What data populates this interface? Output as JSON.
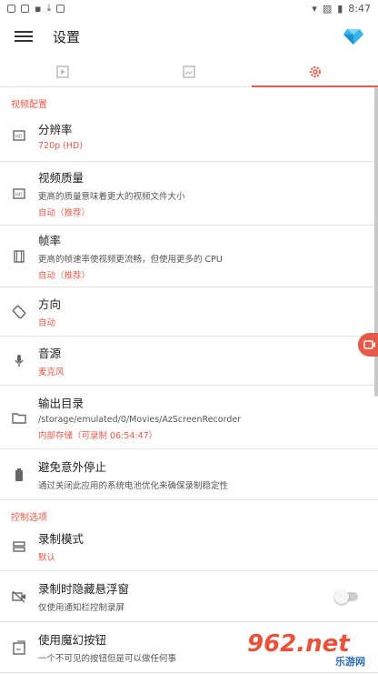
{
  "status": {
    "time": "8:47"
  },
  "appbar": {
    "title": "设置"
  },
  "tabs": [
    {
      "name": "videos",
      "icon": "video-list-icon"
    },
    {
      "name": "images",
      "icon": "image-icon"
    },
    {
      "name": "settings",
      "icon": "gear-icon"
    }
  ],
  "sections": {
    "video": "视频配置",
    "control": "控制选项"
  },
  "rows": {
    "resolution": {
      "title": "分辨率",
      "value": "720p (HD)"
    },
    "quality": {
      "title": "视频质量",
      "desc": "更高的质量意味着更大的视频文件大小",
      "value": "自动（推荐）"
    },
    "fps": {
      "title": "帧率",
      "desc": "更高的帧速率使视频更流畅，但使用更多的 CPU",
      "value": "自动（推荐）"
    },
    "orientation": {
      "title": "方向",
      "value": "自动"
    },
    "audio": {
      "title": "音源",
      "value": "麦克风"
    },
    "output": {
      "title": "输出目录",
      "desc": "/storage/emulated/0/Movies/AzScreenRecorder",
      "value": "内部存储（可录制 06:54:47）"
    },
    "battery": {
      "title": "避免意外停止",
      "desc": "通过关闭此应用的系统电池优化来确保录制稳定性"
    },
    "mode": {
      "title": "录制模式",
      "value": "默认"
    },
    "hide_float": {
      "title": "录制时隐藏悬浮窗",
      "desc": "仅使用通知栏控制录屏",
      "enabled": false
    },
    "magic": {
      "title": "使用魔幻按钮",
      "desc": "一个不可见的按钮但是可以做任何事"
    }
  },
  "watermark": {
    "logo": "962.net",
    "sub": "乐游网"
  },
  "colors": {
    "accent": "#e65a4a"
  }
}
